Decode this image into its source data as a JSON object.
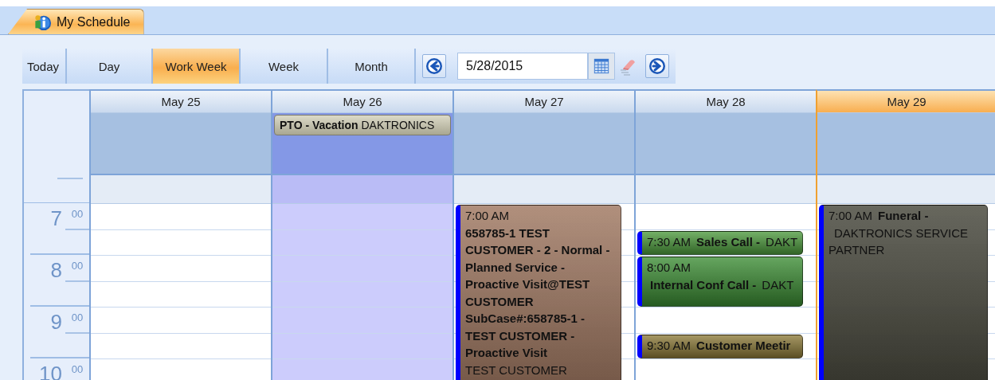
{
  "tabs": [
    {
      "label": "My Schedule",
      "selected": true
    }
  ],
  "toolbar": {
    "buttons": [
      {
        "label": "Today",
        "selected": false
      },
      {
        "label": "Day",
        "selected": false
      },
      {
        "label": "Work Week",
        "selected": true
      },
      {
        "label": "Week",
        "selected": false
      },
      {
        "label": "Month",
        "selected": false
      }
    ],
    "date": {
      "value": "5/28/2015"
    }
  },
  "days": [
    {
      "label": "May 25",
      "today": false,
      "out_of_office": false
    },
    {
      "label": "May 26",
      "today": false,
      "out_of_office": true,
      "all_day": [
        {
          "title": "PTO - Vacation",
          "location": "DAKTRONICS"
        }
      ]
    },
    {
      "label": "May 27",
      "today": false,
      "out_of_office": false,
      "events": [
        {
          "kind": "long",
          "time": "7:00 AM",
          "title": "658785-1 TEST CUSTOMER - 2 - Normal - Planned Service - Proactive Visit@TEST CUSTOMER SubCase#:658785-1 - TEST CUSTOMER - Proactive Visit",
          "location": "TEST CUSTOMER",
          "time_on_own_line": true,
          "location_on_own_line": true,
          "color": "#9a7058"
        }
      ]
    },
    {
      "label": "May 28",
      "today": false,
      "out_of_office": false,
      "events": [
        {
          "kind": "half",
          "time": "7:30 AM",
          "title": "Sales Call -",
          "location": "DAKT",
          "time_on_own_line": false,
          "location_on_own_line": false,
          "color": "#4c9a3c"
        },
        {
          "kind": "hour",
          "time": "8:00 AM",
          "title": "Internal Conf Call -",
          "location": "DAKT",
          "time_on_own_line": true,
          "location_on_own_line": false,
          "color": "#3a8c32"
        },
        {
          "kind": "half",
          "time": "9:30 AM",
          "title": "Customer Meetir",
          "time_on_own_line": false,
          "location_on_own_line": false,
          "color": "#8c7a38"
        }
      ]
    },
    {
      "label": "May 29",
      "today": true,
      "out_of_office": false,
      "events": [
        {
          "kind": "long",
          "time": "7:00 AM",
          "title": "Funeral -",
          "location": "DAKTRONICS SERVICE PARTNER",
          "time_on_own_line": false,
          "location_on_own_line": false,
          "color": "#3c3c30"
        }
      ]
    }
  ],
  "hours": [
    {
      "hour": "7",
      "minutes": "00"
    },
    {
      "hour": "8",
      "minutes": "00"
    },
    {
      "hour": "9",
      "minutes": "00"
    },
    {
      "hour": "10",
      "minutes": "00"
    }
  ]
}
